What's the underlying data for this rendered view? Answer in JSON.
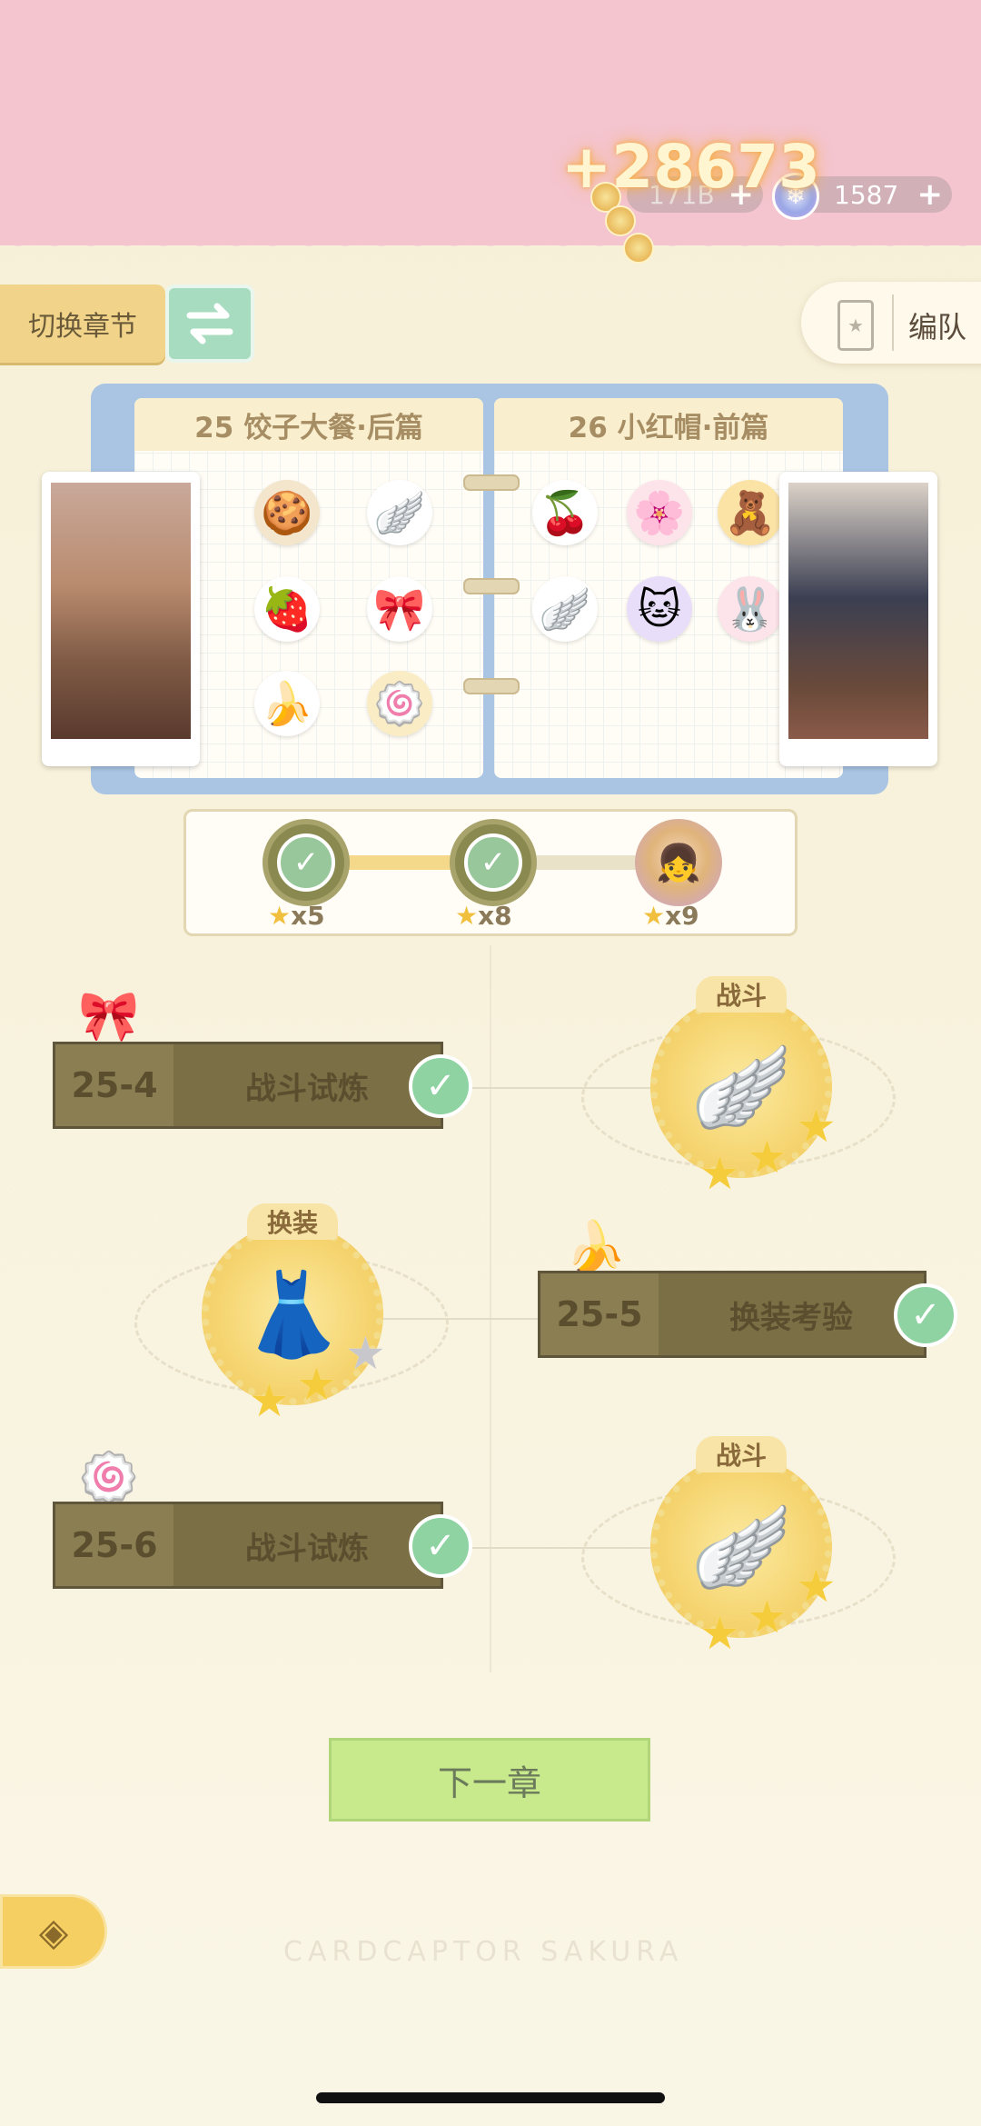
{
  "header": {
    "gain": "+28673",
    "coins": "171B",
    "gems": "1587"
  },
  "nav": {
    "switch_chapter": "切换章节",
    "formation": "编队"
  },
  "book": {
    "left_title": "25 饺子大餐·后篇",
    "right_title": "26 小红帽·前篇",
    "left_stickers": [
      "cookie",
      "wing",
      "strawberry",
      "bow",
      "banana",
      "roll"
    ],
    "right_stickers": [
      "cherry",
      "flower",
      "bear",
      "wing",
      "cat",
      "bunny"
    ]
  },
  "progress": {
    "milestones": [
      {
        "count": "x5",
        "state": "claimed"
      },
      {
        "count": "x8",
        "state": "claimed"
      },
      {
        "count": "x9",
        "state": "locked"
      }
    ],
    "fill_fraction": 0.5
  },
  "stages": [
    {
      "code": "25-4",
      "label": "战斗试炼",
      "completed": true
    },
    {
      "code": "25-5",
      "label": "换装考验",
      "completed": true
    },
    {
      "code": "25-6",
      "label": "战斗试炼",
      "completed": true
    }
  ],
  "badges": [
    {
      "tag": "战斗",
      "stars_earned": 3,
      "stars_total": 3
    },
    {
      "tag": "换装",
      "stars_earned": 2,
      "stars_total": 3
    },
    {
      "tag": "战斗",
      "stars_earned": 3,
      "stars_total": 3
    }
  ],
  "next_chapter": "下一章",
  "watermark": "CARDCAPTOR SAKURA"
}
